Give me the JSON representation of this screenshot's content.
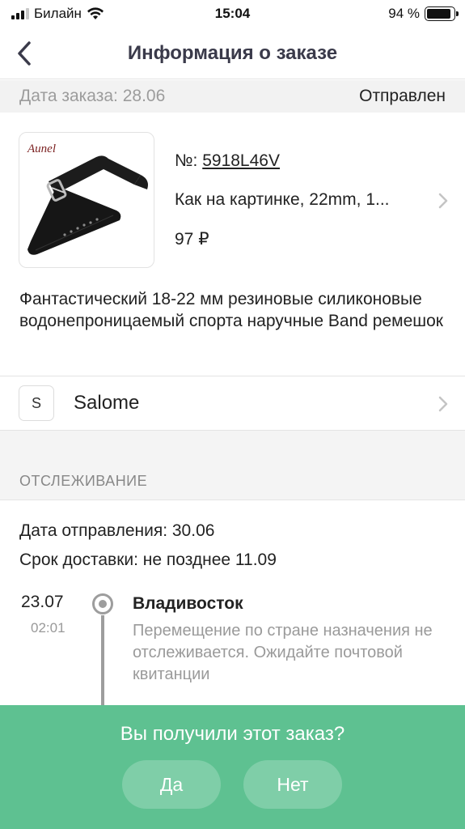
{
  "status_bar": {
    "carrier": "Билайн",
    "time": "15:04",
    "battery": "94 %",
    "battery_level": 0.94,
    "signal_bars": 3,
    "icons": [
      "signal-icon",
      "wifi-icon",
      "battery-icon"
    ]
  },
  "nav": {
    "title": "Информация о заказе",
    "back_icon": "chevron-left-icon"
  },
  "order": {
    "date_label": "Дата заказа: 28.06",
    "status": "Отправлен"
  },
  "product": {
    "number_label": "№:",
    "number": "5918L46V",
    "variant": "Как на картинке, 22mm, 1...",
    "price": "97 ₽",
    "image_brand": "Aunel",
    "description": "Фантастический 18-22 мм резиновые силиконовые водонепроницаемый спорта наручные Band ремешок"
  },
  "seller": {
    "initial": "S",
    "name": "Salome"
  },
  "tracking": {
    "section_title": "ОТСЛЕЖИВАНИЕ",
    "ship_date": "Дата отправления: 30.06",
    "delivery_term": "Срок доставки: не позднее 11.09",
    "events": [
      {
        "date": "23.07",
        "time": "02:01",
        "city": "Владивосток",
        "note": "Перемещение по стране назначения не отслеживается. Ожидайте почтовой квитанции"
      }
    ]
  },
  "prompt": {
    "question": "Вы получили этот заказ?",
    "yes_label": "Да",
    "no_label": "Нет"
  },
  "colors": {
    "accent_green": "#5ec191",
    "button_green": "#7fcea8",
    "title_dark": "#3a3a4a",
    "muted_gray": "#9a9a9a"
  }
}
